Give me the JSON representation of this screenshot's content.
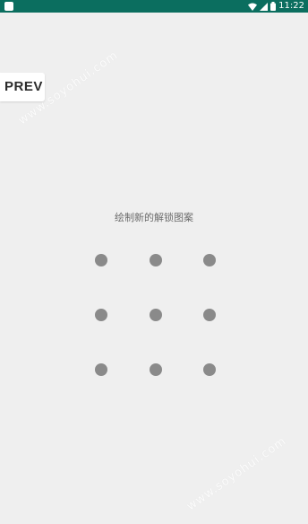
{
  "status_bar": {
    "time": "11:22",
    "icons": [
      "app-notification-icon",
      "wifi-icon",
      "signal-icon",
      "battery-icon"
    ],
    "background_color": "#0b6e5f"
  },
  "prev_button": {
    "label": "PREV"
  },
  "prompt": {
    "text": "绘制新的解锁图案"
  },
  "pattern_grid": {
    "rows": 3,
    "cols": 3,
    "dot_color": "#8a8a8a"
  },
  "watermarks": [
    "www.soyohui.com",
    "www.soyohui.com"
  ]
}
